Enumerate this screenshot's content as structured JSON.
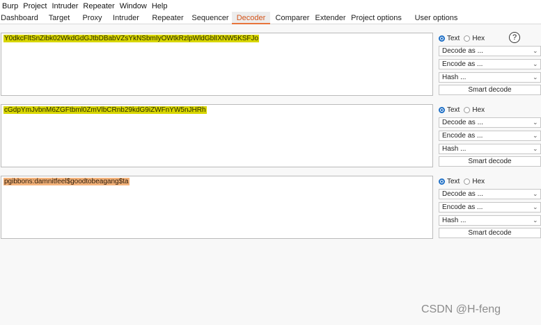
{
  "menu": [
    "Burp",
    "Project",
    "Intruder",
    "Repeater",
    "Window",
    "Help"
  ],
  "tabs": [
    "Dashboard",
    "Target",
    "Proxy",
    "Intruder",
    "Repeater",
    "Sequencer",
    "Decoder",
    "Comparer",
    "Extender",
    "Project options",
    "User options"
  ],
  "active_tab": "Decoder",
  "panels": [
    {
      "text": "Y0dkcFltSnZibk02WkdGdGJtbDBabVZsYkNSbmIyOWtkRzlpWldGblIXNW5KSFJo",
      "highlight": "yellow",
      "text_radio": "Text",
      "hex_radio": "Hex",
      "selected": "Text",
      "decode_as": "Decode as ...",
      "encode_as": "Encode as ...",
      "hash": "Hash ...",
      "smart_decode": "Smart decode"
    },
    {
      "text": "cGdpYmJvbnM6ZGFtbml0ZmVlbCRnb29kdG9iZWFnYW5nJHRh",
      "highlight": "yellow",
      "text_radio": "Text",
      "hex_radio": "Hex",
      "selected": "Text",
      "decode_as": "Decode as ...",
      "encode_as": "Encode as ...",
      "hash": "Hash ...",
      "smart_decode": "Smart decode"
    },
    {
      "text": "pgibbons:damnitfeel$goodtobeagang$ta",
      "highlight": "orange",
      "text_radio": "Text",
      "hex_radio": "Hex",
      "selected": "Text",
      "decode_as": "Decode as ...",
      "encode_as": "Encode as ...",
      "hash": "Hash ...",
      "smart_decode": "Smart decode"
    }
  ],
  "help_icon": {
    "glyph": "?"
  },
  "watermark": "CSDN @H-feng",
  "colors": {
    "accent": "#e8743b",
    "highlight_yellow": "#d8d600",
    "highlight_orange": "#f3b27a",
    "radio_blue": "#1e6fc6"
  }
}
